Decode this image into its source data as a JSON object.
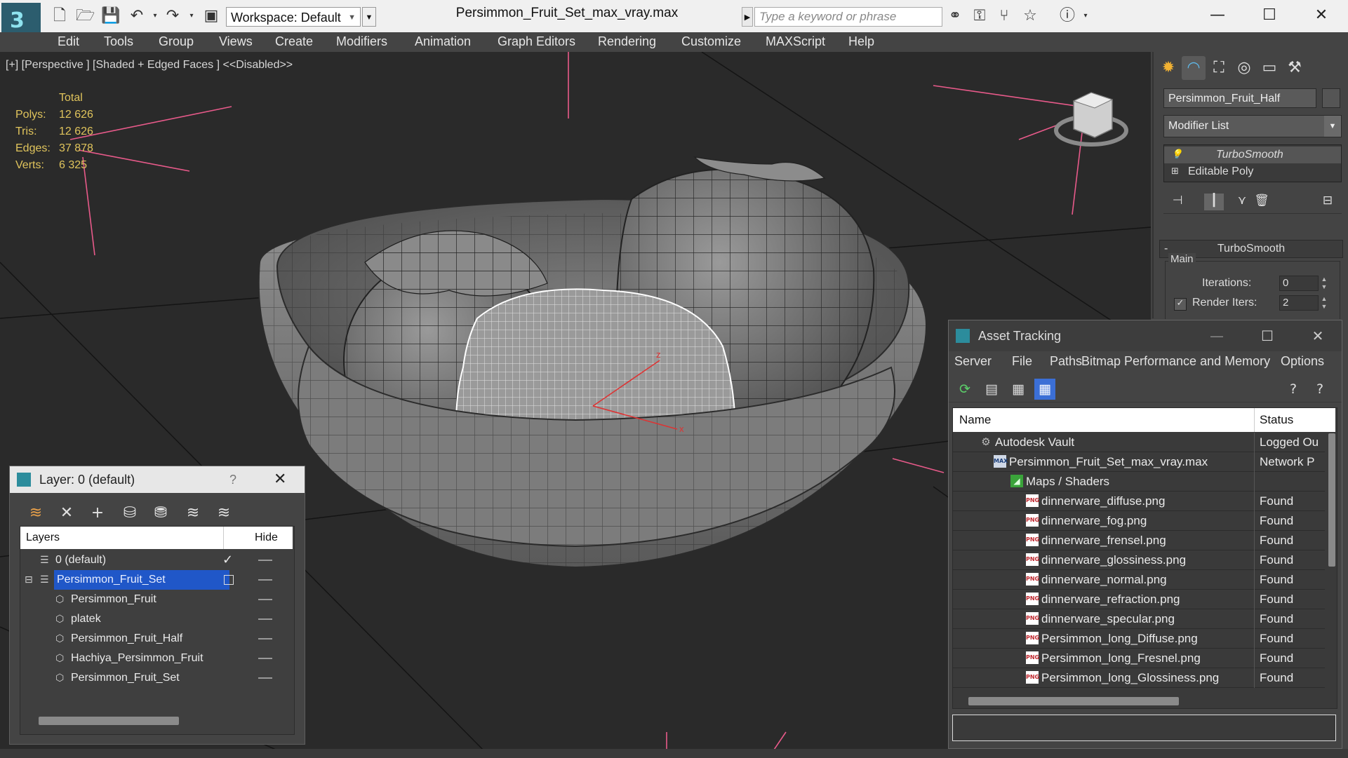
{
  "app": {
    "document_title": "Persimmon_Fruit_Set_max_vray.max",
    "workspace_label": "Workspace: Default",
    "search_placeholder": "Type a keyword or phrase",
    "icons": [
      "app-logo-icon",
      "new-file-icon",
      "open-file-icon",
      "save-icon",
      "undo-icon",
      "redo-icon",
      "project-icon",
      "binoculars-icon",
      "key-icon",
      "fork-icon",
      "star-icon",
      "help-icon"
    ]
  },
  "menu": [
    "Edit",
    "Tools",
    "Group",
    "Views",
    "Create",
    "Modifiers",
    "Animation",
    "Graph Editors",
    "Rendering",
    "Customize",
    "MAXScript",
    "Help"
  ],
  "viewport": {
    "label": "[+] [Perspective ] [Shaded + Edged Faces ]  <<Disabled>>",
    "stats": {
      "header": "Total",
      "rows": [
        {
          "k": "Polys:",
          "v": "12 626"
        },
        {
          "k": "Tris:",
          "v": "12 626"
        },
        {
          "k": "Edges:",
          "v": "37 878"
        },
        {
          "k": "Verts:",
          "v": "6 325"
        }
      ]
    },
    "gizmo_axis_labels": [
      "z",
      "x"
    ]
  },
  "command_panel": {
    "object_name": "Persimmon_Fruit_Half",
    "modifier_list": "Modifier List",
    "stack": [
      {
        "label": "TurboSmooth",
        "icon": "bulb-icon"
      },
      {
        "label": "Editable Poly",
        "icon": "plus-icon"
      }
    ],
    "rollout_title": "TurboSmooth",
    "rollout_collapse": "-",
    "group_title": "Main",
    "iterations_label": "Iterations:",
    "iterations_value": "0",
    "render_iters_label": "Render Iters:",
    "render_iters_value": "2",
    "render_iters_checked": true
  },
  "layer_explorer": {
    "title": "Layer: 0 (default)",
    "help": "?",
    "col_layers": "Layers",
    "col_hide": "Hide",
    "rows": [
      {
        "name": "0 (default)",
        "indent": 1,
        "icon": "layer-stack-icon",
        "active": true
      },
      {
        "name": "Persimmon_Fruit_Set",
        "indent": 1,
        "icon": "layer-stack-icon",
        "selected": true
      },
      {
        "name": "Persimmon_Fruit",
        "indent": 2,
        "icon": "object-icon"
      },
      {
        "name": "platek",
        "indent": 2,
        "icon": "object-icon"
      },
      {
        "name": "Persimmon_Fruit_Half",
        "indent": 2,
        "icon": "object-icon"
      },
      {
        "name": "Hachiya_Persimmon_Fruit",
        "indent": 2,
        "icon": "object-icon"
      },
      {
        "name": "Persimmon_Fruit_Set",
        "indent": 2,
        "icon": "object-icon"
      }
    ]
  },
  "asset_tracking": {
    "title": "Asset Tracking",
    "menu": [
      "Server",
      "File",
      "Paths",
      "Bitmap Performance and Memory",
      "Options"
    ],
    "col_name": "Name",
    "col_status": "Status",
    "rows": [
      {
        "name": "Autodesk Vault",
        "status": "Logged Ou",
        "indent": 1,
        "type": "vault"
      },
      {
        "name": "Persimmon_Fruit_Set_max_vray.max",
        "status": "Network P",
        "indent": 2,
        "type": "max"
      },
      {
        "name": "Maps / Shaders",
        "status": "",
        "indent": 3,
        "type": "maps"
      },
      {
        "name": "dinnerware_diffuse.png",
        "status": "Found",
        "indent": 4,
        "type": "png"
      },
      {
        "name": "dinnerware_fog.png",
        "status": "Found",
        "indent": 4,
        "type": "png"
      },
      {
        "name": "dinnerware_frensel.png",
        "status": "Found",
        "indent": 4,
        "type": "png"
      },
      {
        "name": "dinnerware_glossiness.png",
        "status": "Found",
        "indent": 4,
        "type": "png"
      },
      {
        "name": "dinnerware_normal.png",
        "status": "Found",
        "indent": 4,
        "type": "png"
      },
      {
        "name": "dinnerware_refraction.png",
        "status": "Found",
        "indent": 4,
        "type": "png"
      },
      {
        "name": "dinnerware_specular.png",
        "status": "Found",
        "indent": 4,
        "type": "png"
      },
      {
        "name": "Persimmon_long_Diffuse.png",
        "status": "Found",
        "indent": 4,
        "type": "png"
      },
      {
        "name": "Persimmon_long_Fresnel.png",
        "status": "Found",
        "indent": 4,
        "type": "png"
      },
      {
        "name": "Persimmon_long_Glossiness.png",
        "status": "Found",
        "indent": 4,
        "type": "png"
      }
    ]
  },
  "colors": {
    "stats_text": "#e0c45c",
    "selection": "#2057c8",
    "grid_highlight": "#e85a8a",
    "active_tool": "#3b6fd6"
  }
}
